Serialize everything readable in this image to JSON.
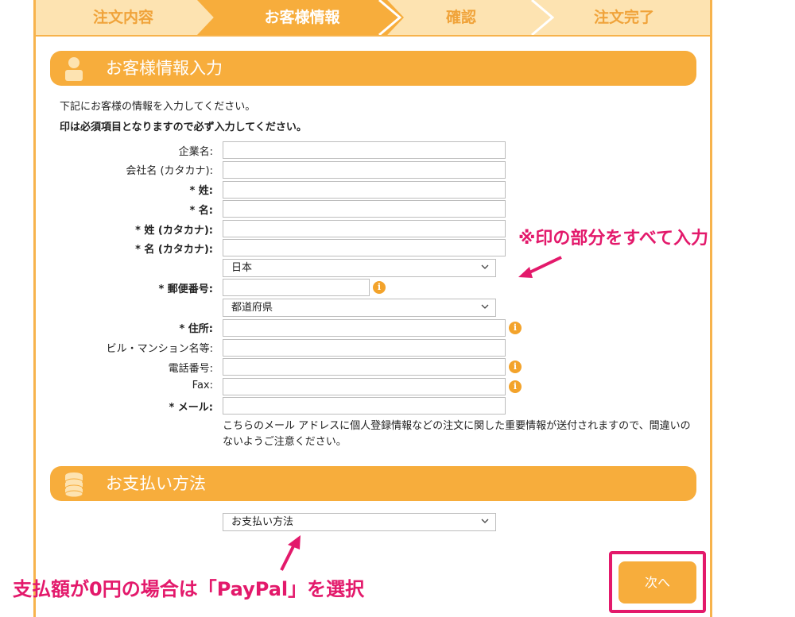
{
  "steps": [
    "注文内容",
    "お客様情報",
    "確認",
    "注文完了"
  ],
  "customer_section": {
    "title": "お客様情報入力",
    "intro": "下記にお客様の情報を入力してください。",
    "required_note": "印は必須項目となりますので必ず入力してください。"
  },
  "form": {
    "company": "企業名:",
    "company_kana": "会社名 (カタカナ):",
    "last_name": "* 姓:",
    "first_name": "* 名:",
    "last_name_kana": "* 姓 (カタカナ):",
    "first_name_kana": "* 名 (カタカナ):",
    "country_value": "日本",
    "postal": "* 郵便番号:",
    "prefecture_value": "都道府県",
    "address": "* 住所:",
    "building": "ビル・マンション名等:",
    "phone": "電話番号:",
    "fax": "Fax:",
    "email": "* メール:",
    "email_note": "こちらのメール アドレスに個人登録情報などの注文に関した重要情報が送付されますので、間違いのないようご注意ください。"
  },
  "payment_section": {
    "title": "お支払い方法",
    "select_value": "お支払い方法"
  },
  "next_button": "次へ",
  "annotations": {
    "required_hint": "※印の部分をすべて入力",
    "paypal_hint": "支払額が0円の場合は「PayPal」を選択"
  },
  "colors": {
    "accent": "#f7ad3c",
    "step_bg": "#fde3b1",
    "annotation": "#e3196b"
  },
  "icons": {
    "info": "i"
  }
}
